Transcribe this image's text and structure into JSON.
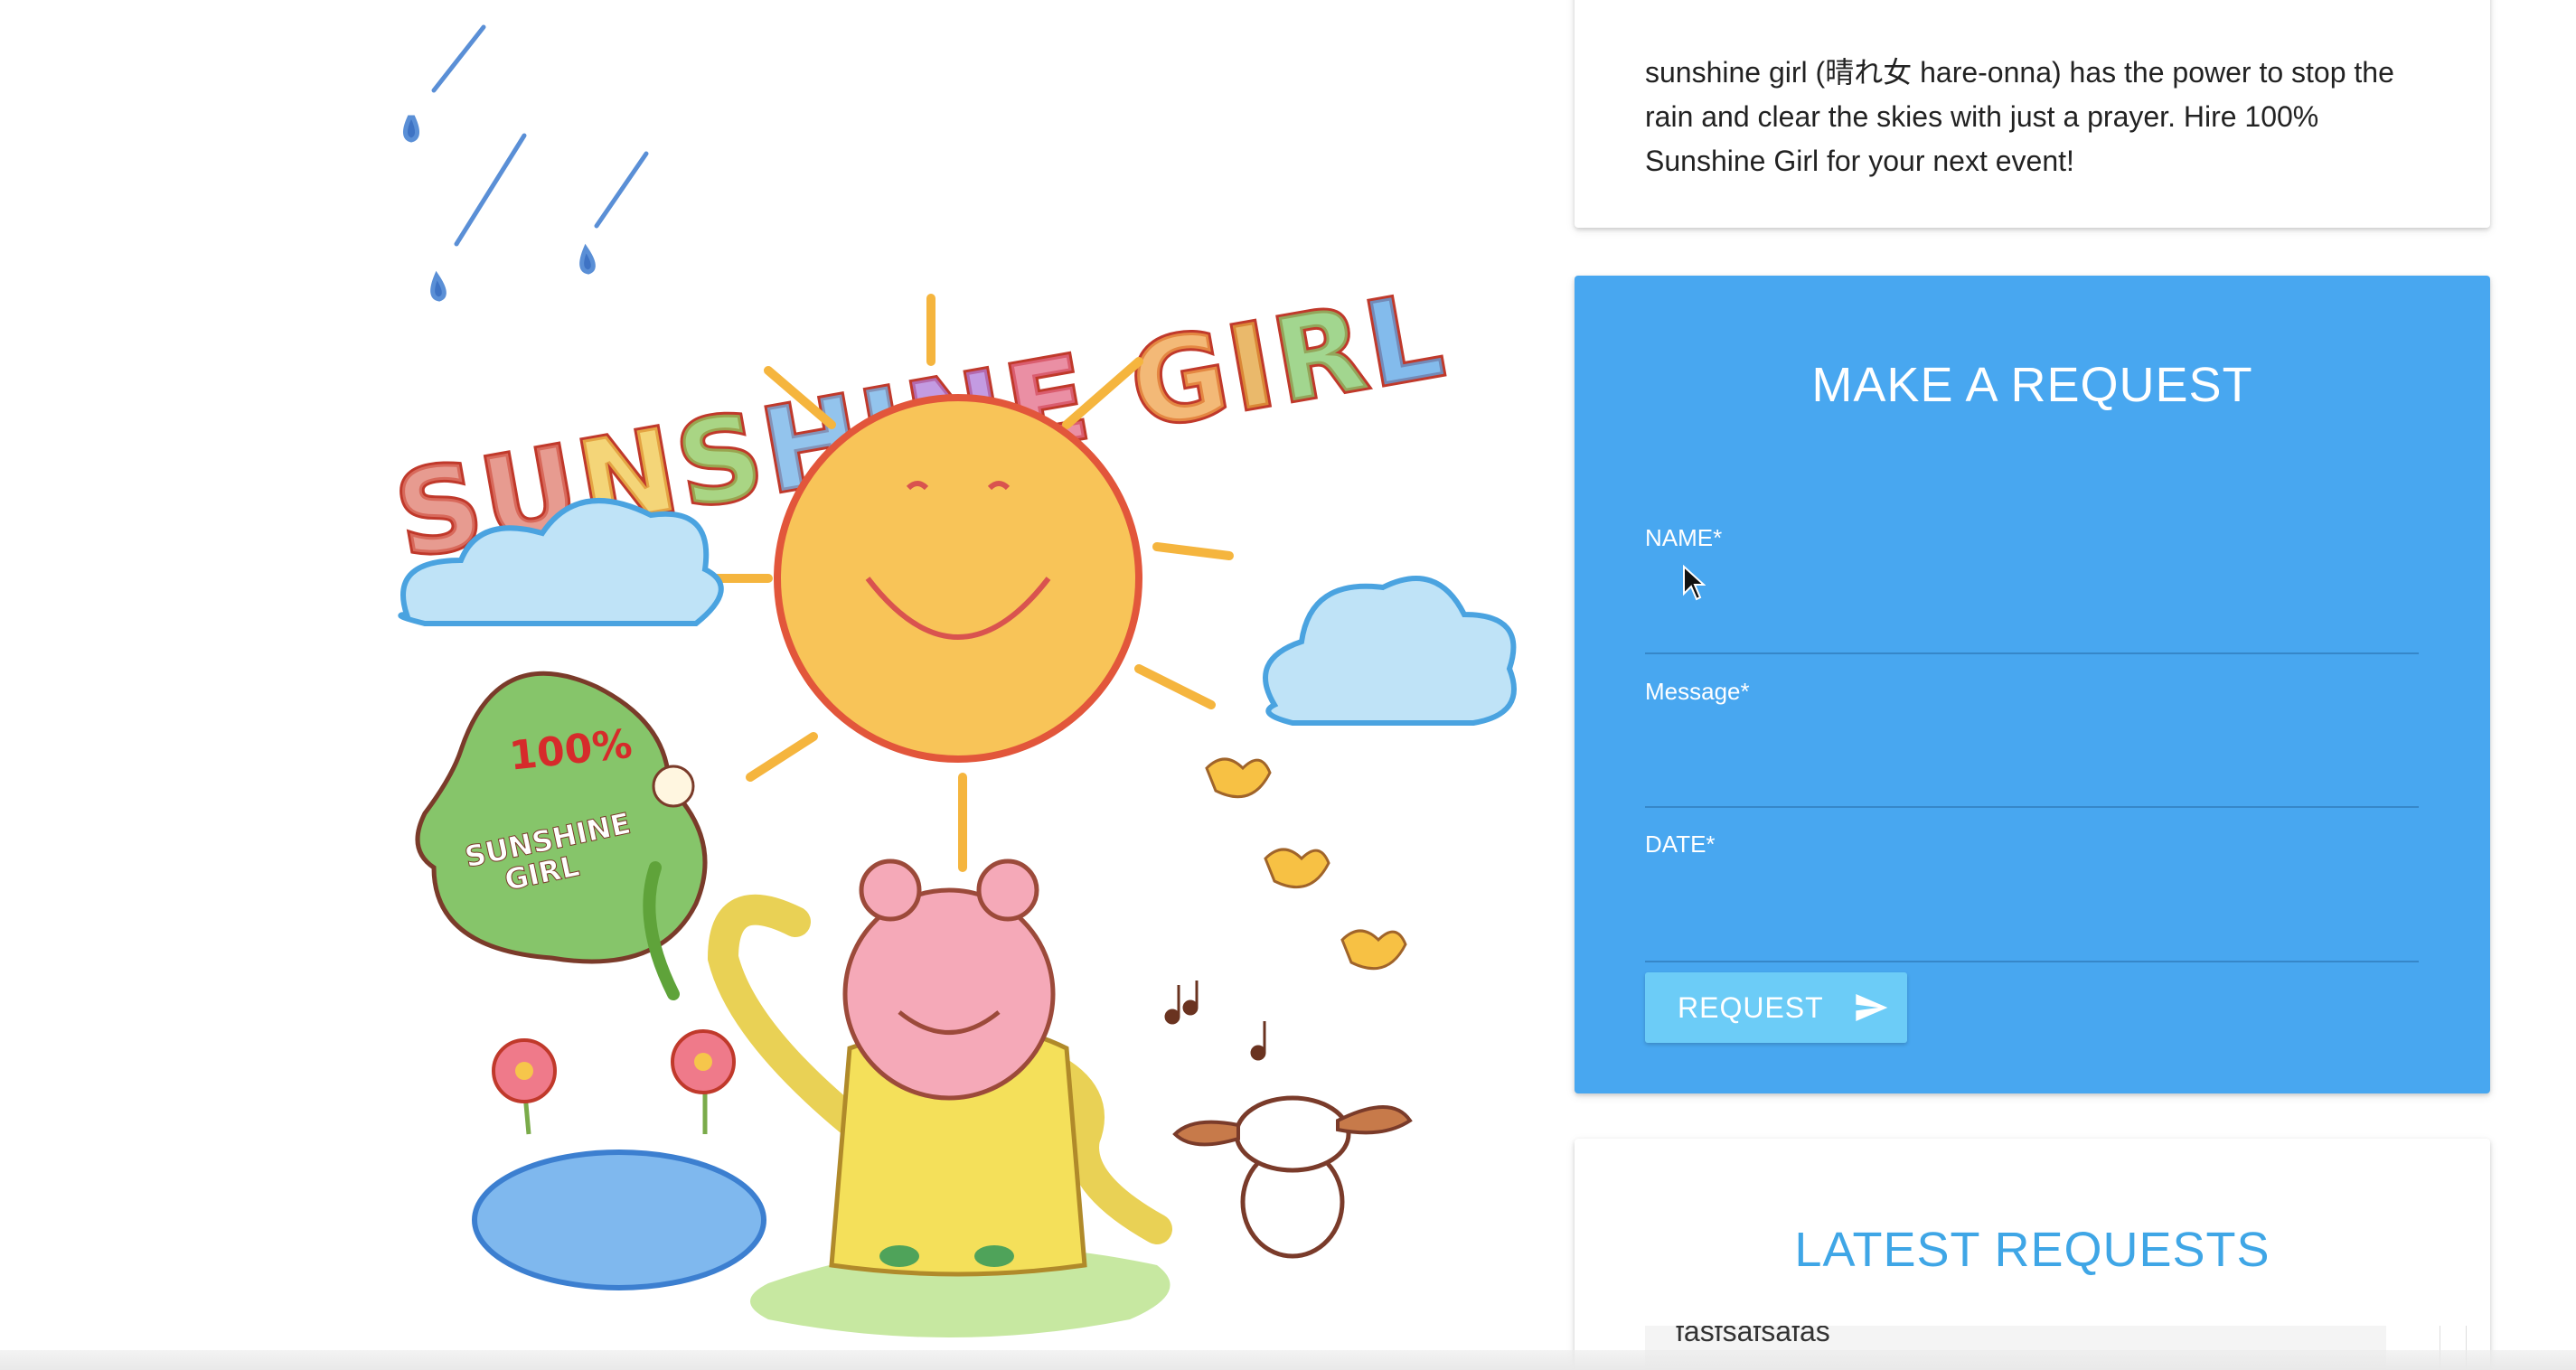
{
  "illustration": {
    "title": "SUNSHINE GIRL",
    "leaf_line1": "100%",
    "leaf_line2": "SUNSHINE",
    "leaf_line3": "GIRL"
  },
  "intro": {
    "text": "sunshine girl (晴れ女 hare-onna) has the power to stop the rain and clear the skies with just a prayer. Hire 100% Sunshine Girl for your next event!"
  },
  "request_form": {
    "title": "MAKE A REQUEST",
    "name_label": "NAME*",
    "name_value": "",
    "message_label": "Message*",
    "message_value": "",
    "date_label": "DATE*",
    "date_value": "",
    "submit_label": "REQUEST",
    "submit_icon": "send-icon",
    "accent_color": "#48a7f0",
    "button_color": "#6cccf7"
  },
  "latest": {
    "title": "LATEST REQUESTS",
    "items": [
      "fasfsafsafas"
    ],
    "title_color": "#3fa6e6"
  }
}
